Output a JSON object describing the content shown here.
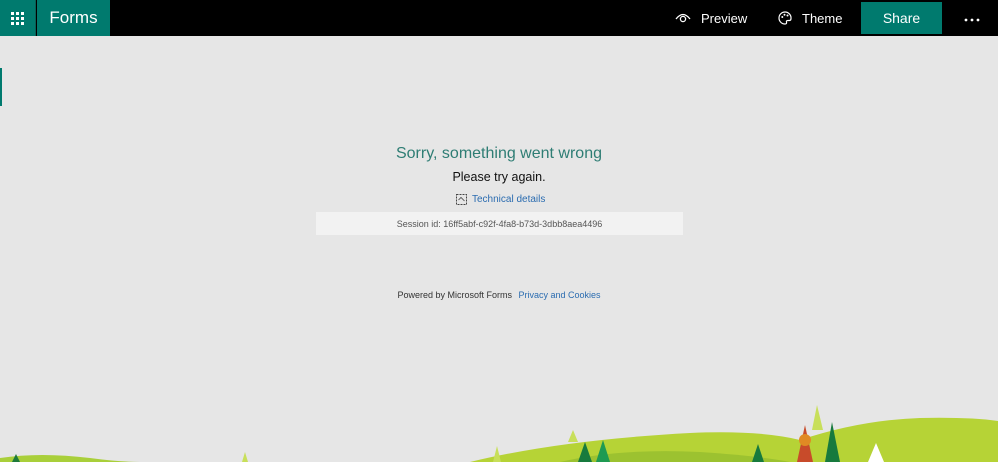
{
  "app": {
    "name": "Forms"
  },
  "header": {
    "preview_label": "Preview",
    "theme_label": "Theme",
    "share_label": "Share",
    "icons": {
      "waffle": "app-launcher-icon",
      "preview": "eye-icon",
      "theme": "palette-icon",
      "more": "more-options-icon"
    }
  },
  "error": {
    "title": "Sorry, something went wrong",
    "message": "Please try again.",
    "technical_details": "Technical details",
    "session": "Session id: 16ff5abf-c92f-4fa8-b73d-3dbb8aea4496"
  },
  "footer": {
    "powered_by": "Powered by Microsoft Forms",
    "privacy_link": "Privacy and Cookies"
  },
  "colors": {
    "accent": "#007a6e",
    "background": "#e6e6e6",
    "title": "#2e7d74",
    "link": "#2b6cb0"
  }
}
